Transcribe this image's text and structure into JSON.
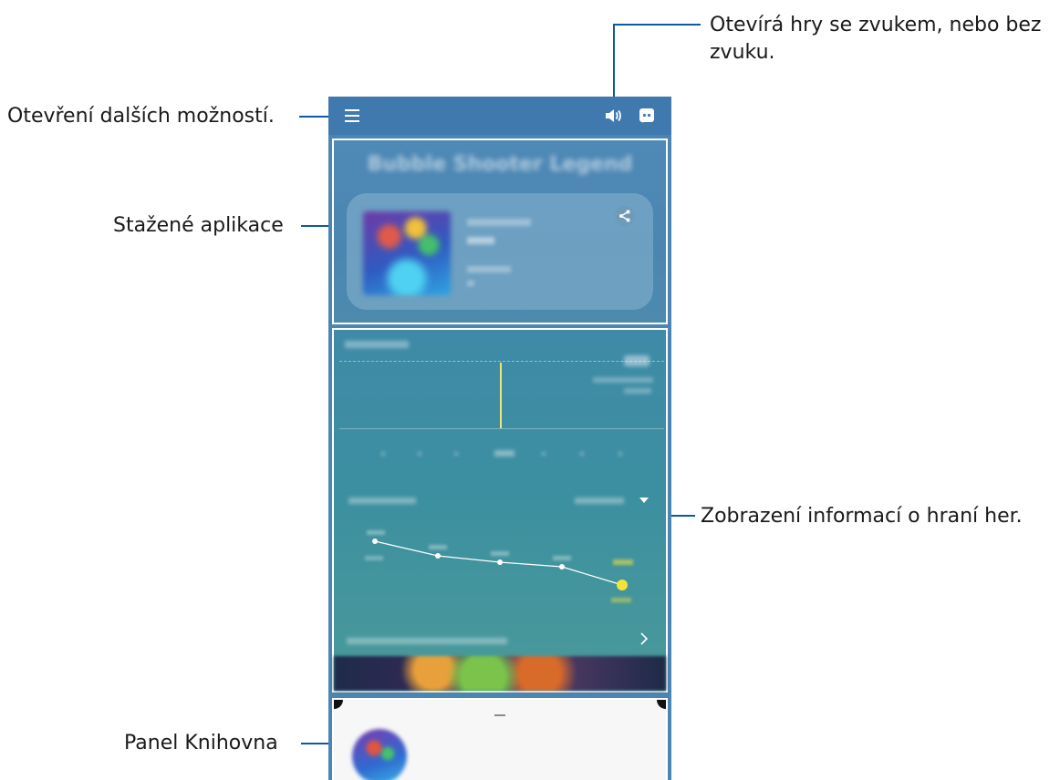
{
  "callouts": {
    "sound": {
      "line1": "Otevírá hry se zvukem, nebo bez",
      "line2": "zvuku."
    },
    "menu": "Otevření dalších možností.",
    "downloaded_apps": "Stažené aplikace",
    "game_info": "Zobrazení informací o hraní her.",
    "library": "Panel Knihovna"
  },
  "screen": {
    "top_bar": {
      "menu_icon": "menu-icon",
      "sound_icon": "volume-icon",
      "discord_icon": "discord-icon"
    },
    "apps_section": {
      "title_blurred": "Bubble Shooter Legend",
      "share_icon": "share-icon"
    },
    "library_panel": {
      "handle": "drag-handle"
    }
  },
  "colors": {
    "leader_line": "#0d5aa0",
    "topbar": "#3f79ad",
    "apps_bg": "#4b86b0",
    "info_bg": "#3c8fa0",
    "highlight_point": "#f3e23a"
  }
}
